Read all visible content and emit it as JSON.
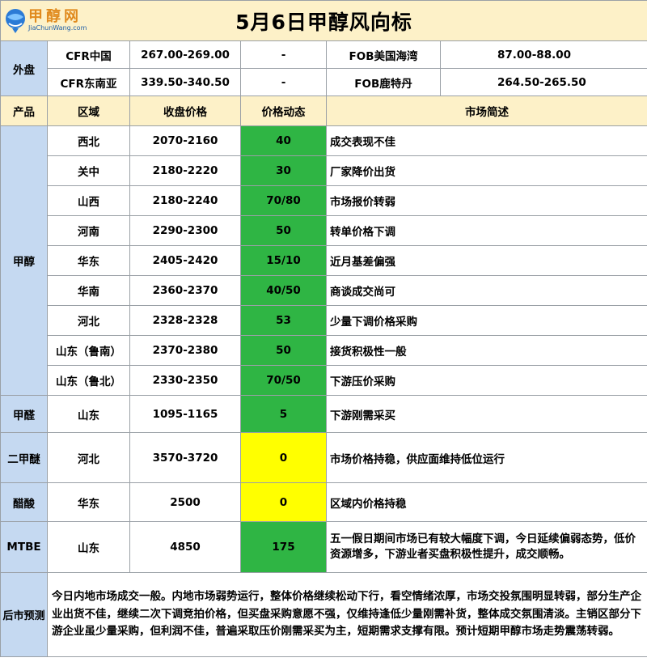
{
  "title": "5月6日甲醇风向标",
  "logo": {
    "cn": "甲醇网",
    "en": "JiaChunWang.com"
  },
  "colors": {
    "title_bg": "#fdf1c8",
    "label_bg": "#c5d9f1",
    "up_green": "#2fb544",
    "flat_yellow": "#ffff00"
  },
  "foreign": {
    "label": "外盘",
    "rows": [
      {
        "name1": "CFR中国",
        "price1": "267.00-269.00",
        "chg1": "-",
        "name2": "FOB美国海湾",
        "price2": "87.00-88.00",
        "chg2": "-"
      },
      {
        "name1": "CFR东南亚",
        "price1": "339.50-340.50",
        "chg1": "-",
        "name2": "FOB鹿特丹",
        "price2": "264.50-265.50",
        "chg2": "-"
      }
    ]
  },
  "headers": {
    "product": "产品",
    "region": "区域",
    "price": "收盘价格",
    "change": "价格动态",
    "summary": "市场简述"
  },
  "methanol": {
    "label": "甲醇",
    "rows": [
      {
        "region": "西北",
        "price": "2070-2160",
        "change": "40",
        "summary": "成交表现不佳"
      },
      {
        "region": "关中",
        "price": "2180-2220",
        "change": "30",
        "summary": "厂家降价出货"
      },
      {
        "region": "山西",
        "price": "2180-2240",
        "change": "70/80",
        "summary": "市场报价转弱"
      },
      {
        "region": "河南",
        "price": "2290-2300",
        "change": "50",
        "summary": "转单价格下调"
      },
      {
        "region": "华东",
        "price": "2405-2420",
        "change": "15/10",
        "summary": "近月基差偏强"
      },
      {
        "region": "华南",
        "price": "2360-2370",
        "change": "40/50",
        "summary": "商谈成交尚可"
      },
      {
        "region": "河北",
        "price": "2328-2328",
        "change": "53",
        "summary": "少量下调价格采购"
      },
      {
        "region": "山东（鲁南）",
        "price": "2370-2380",
        "change": "50",
        "summary": "接货积极性一般"
      },
      {
        "region": "山东（鲁北）",
        "price": "2330-2350",
        "change": "70/50",
        "summary": "下游压价采购"
      }
    ]
  },
  "others": [
    {
      "product": "甲醛",
      "region": "山东",
      "price": "1095-1165",
      "change": "5",
      "summary": "下游刚需采买",
      "color": "green"
    },
    {
      "product": "二甲醚",
      "region": "河北",
      "price": "3570-3720",
      "change": "0",
      "summary": "市场价格持稳，供应面维持低位运行",
      "color": "yellow"
    },
    {
      "product": "醋酸",
      "region": "华东",
      "price": "2500",
      "change": "0",
      "summary": "区域内价格持稳",
      "color": "yellow"
    },
    {
      "product": "MTBE",
      "region": "山东",
      "price": "4850",
      "change": "175",
      "summary": "五一假日期间市场已有较大幅度下调，今日延续偏弱态势，低价资源增多，下游业者买盘积极性提升，成交顺畅。",
      "color": "green"
    }
  ],
  "forecast": {
    "label": "后市预测",
    "text": "今日内地市场成交一般。内地市场弱势运行，整体价格继续松动下行，看空情绪浓厚，市场交投氛围明显转弱，部分生产企业出货不佳，继续二次下调竞拍价格，但买盘采购意愿不强，仅维持逢低少量刚需补货，整体成交氛围清淡。主销区部分下游企业虽少量采购，但利润不佳，普遍采取压价刚需采买为主，短期需求支撑有限。预计短期甲醇市场走势震荡转弱。"
  }
}
